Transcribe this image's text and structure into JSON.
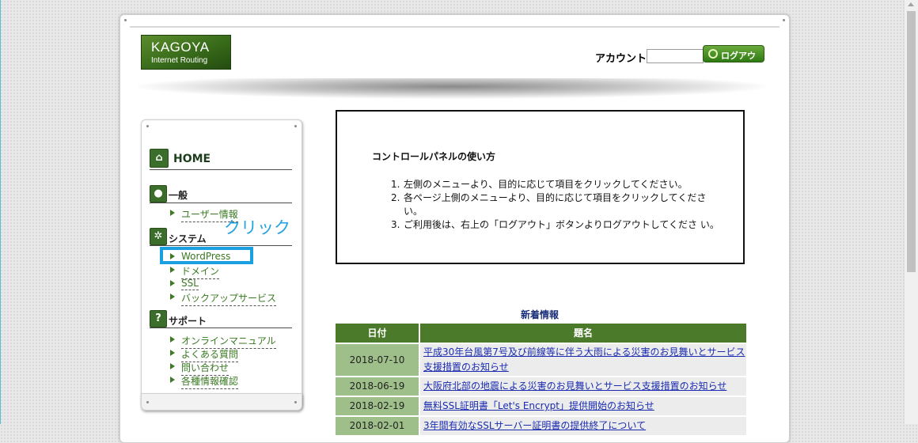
{
  "header": {
    "logo_line1": "KAGOYA",
    "logo_line2": "Internet Routing",
    "account_label": "アカウント:",
    "account_value": "",
    "logout_label": "ログアウト"
  },
  "sidebar": {
    "home": "HOME",
    "sections": [
      {
        "label": "一般",
        "icon": "person-icon",
        "items": [
          "ユーザー情報"
        ]
      },
      {
        "label": "システム",
        "icon": "gear-icon",
        "items": [
          "WordPress",
          "ドメイン",
          "SSL",
          "バックアップサービス"
        ]
      },
      {
        "label": "サポート",
        "icon": "help-icon",
        "items": [
          "オンラインマニュアル",
          "よくある質問",
          "問い合わせ",
          "各種情報確認"
        ]
      }
    ]
  },
  "annotation": {
    "click_label": "クリック",
    "highlight_color": "#1aa0e0"
  },
  "control_panel": {
    "title": "コントロールパネルの使い方",
    "steps": [
      "左側のメニューより、目的に応じて項目をクリックしてください。",
      "各ページ上側のメニューより、目的に応じて項目をクリックしてくださ い。",
      "ご利用後は、右上の「ログアウト」ボタンよりログアウトしてくださ い。"
    ]
  },
  "news": {
    "title": "新着情報",
    "col_date": "日付",
    "col_title": "題名",
    "rows": [
      {
        "date": "2018-07-10",
        "title": "平成30年台風第7号及び前線等に伴う大雨による災害のお見舞いとサービス支援措置のお知らせ"
      },
      {
        "date": "2018-06-19",
        "title": "大阪府北部の地震による災害のお見舞いとサービス支援措置のお知らせ"
      },
      {
        "date": "2018-02-19",
        "title": "無料SSL証明書「Let's Encrypt」提供開始のお知らせ"
      },
      {
        "date": "2018-02-01",
        "title": "3年間有効なSSLサーバー証明書の提供終了について"
      }
    ]
  },
  "colors": {
    "brand_green": "#4c7a2b",
    "link_blue": "#1a2bb0"
  }
}
